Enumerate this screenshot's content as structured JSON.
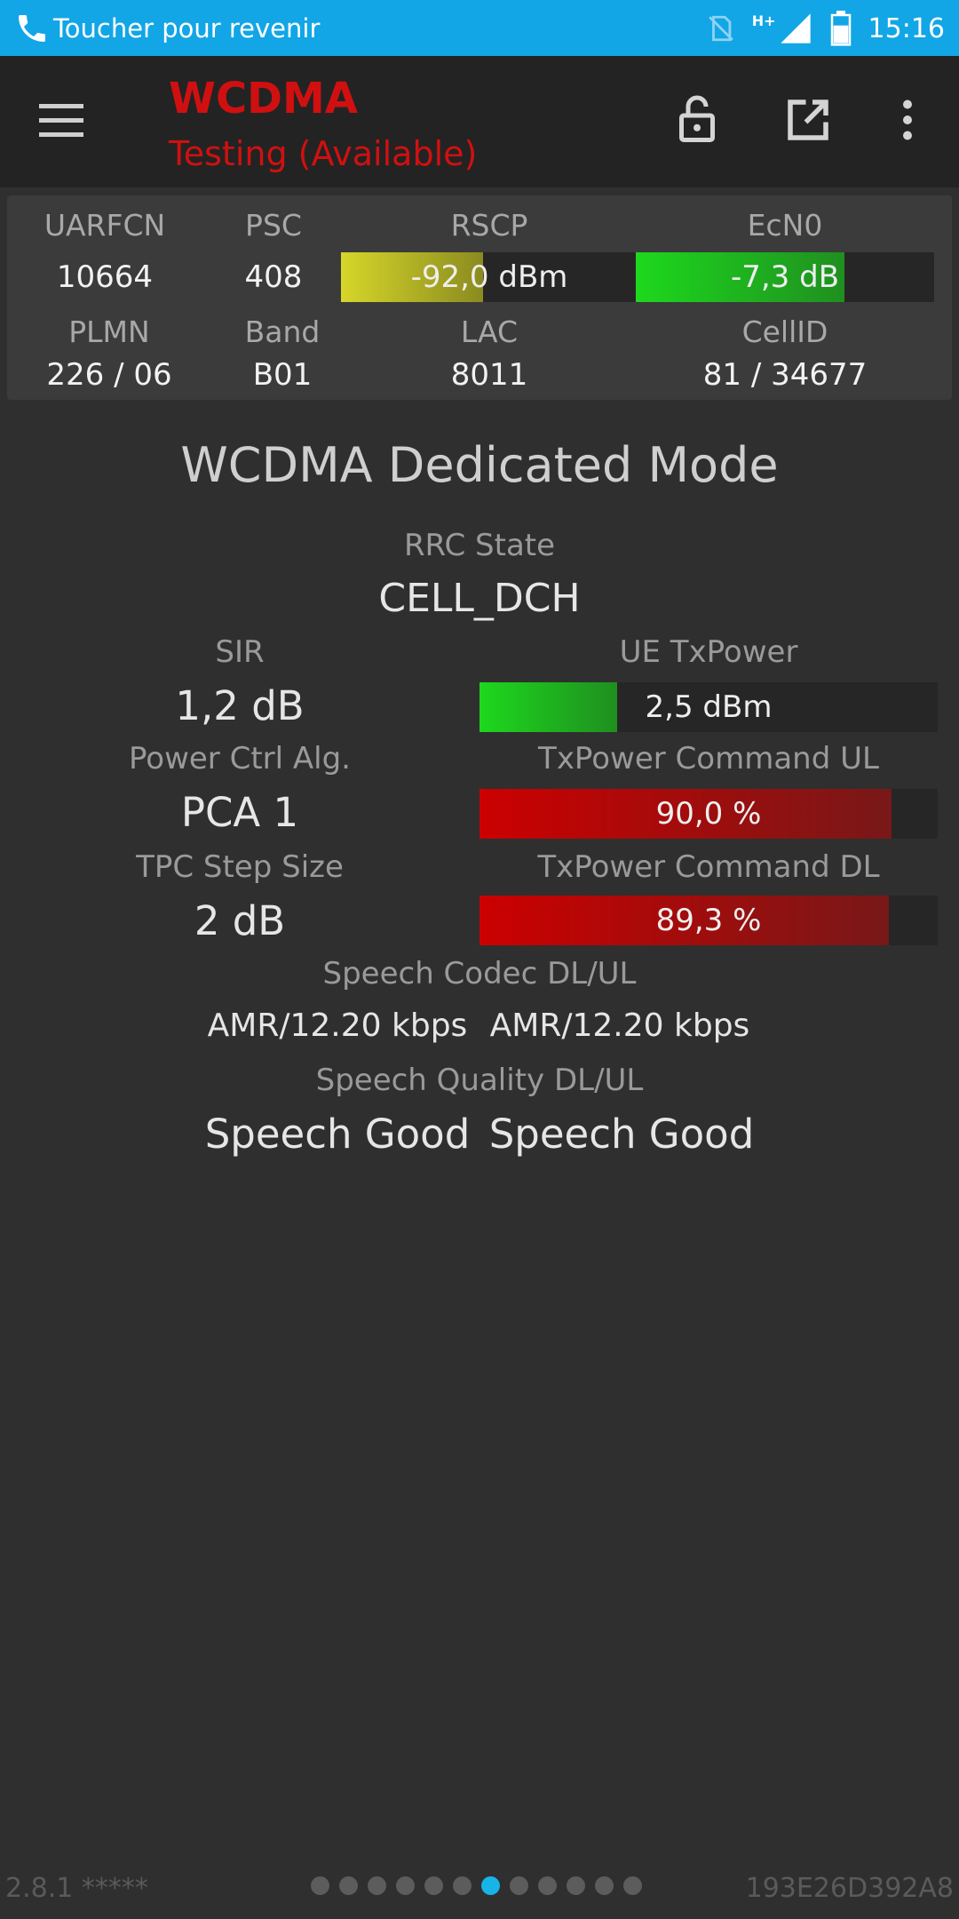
{
  "status_bar": {
    "notification_text": "Toucher pour revenir",
    "network_type": "H+",
    "time": "15:16"
  },
  "app_bar": {
    "title": "WCDMA",
    "subtitle": "Testing (Available)",
    "accent_color": "#d01010"
  },
  "summary": {
    "uarfcn": {
      "label": "UARFCN",
      "value": "10664"
    },
    "psc": {
      "label": "PSC",
      "value": "408"
    },
    "rscp": {
      "label": "RSCP",
      "value": "-92,0 dBm",
      "level": 0.48
    },
    "ecn0": {
      "label": "EcN0",
      "value": "-7,3 dB",
      "level": 0.7
    },
    "plmn": {
      "label": "PLMN",
      "value": "226 / 06"
    },
    "band": {
      "label": "Band",
      "value": "B01"
    },
    "lac": {
      "label": "LAC",
      "value": "8011"
    },
    "cellid": {
      "label": "CellID",
      "value": "81 / 34677"
    }
  },
  "main": {
    "title": "WCDMA Dedicated Mode",
    "rrc_state": {
      "label": "RRC State",
      "value": "CELL_DCH"
    },
    "sir": {
      "label": "SIR",
      "value": "1,2 dB"
    },
    "ue_txpower": {
      "label": "UE TxPower",
      "value": "2,5 dBm",
      "level": 0.3
    },
    "power_ctrl_alg": {
      "label": "Power Ctrl Alg.",
      "value": "PCA 1"
    },
    "txpower_cmd_ul": {
      "label": "TxPower Command UL",
      "value": "90,0 %",
      "level": 0.9
    },
    "tpc_step_size": {
      "label": "TPC Step Size",
      "value": "2 dB"
    },
    "txpower_cmd_dl": {
      "label": "TxPower Command DL",
      "value": "89,3 %",
      "level": 0.893
    },
    "speech_codec": {
      "label": "Speech Codec DL/UL",
      "dl": "AMR/12.20 kbps",
      "ul": "AMR/12.20 kbps"
    },
    "speech_quality": {
      "label": "Speech Quality DL/UL",
      "dl": "Speech Good",
      "ul": "Speech Good"
    }
  },
  "footer": {
    "version": "2.8.1 *****",
    "device_id": "193E26D392A8",
    "page_count": 12,
    "active_page": 7
  },
  "colors": {
    "status_bar": "#12a6e6",
    "bar_green": "#22c022",
    "bar_yellow": "#d8d82a",
    "bar_red": "#c80000",
    "page_dot_active": "#18b4e8"
  }
}
